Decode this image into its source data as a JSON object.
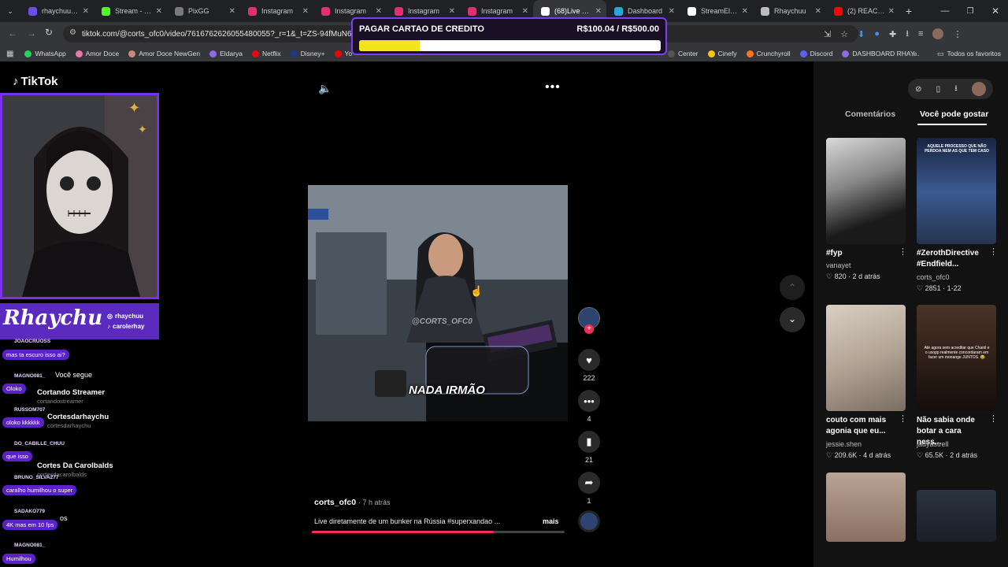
{
  "browser": {
    "tabs": [
      {
        "title": "rhaychuu - T",
        "color": "#6b4ee6"
      },
      {
        "title": "Stream - Kic",
        "color": "#53fc18"
      },
      {
        "title": "PixGG",
        "color": "#7a7a7a"
      },
      {
        "title": "Instagram",
        "color": "#e1306c"
      },
      {
        "title": "Instagram",
        "color": "#e1306c"
      },
      {
        "title": "Instagram",
        "color": "#e1306c"
      },
      {
        "title": "Instagram",
        "color": "#e1306c"
      },
      {
        "title": "(68)Live dire",
        "color": "#ffffff"
      },
      {
        "title": "Dashboard",
        "color": "#2aa7d8"
      },
      {
        "title": "StreamElem",
        "color": "#ffffff"
      },
      {
        "title": "Rhaychuu",
        "color": "#bbbbbb"
      },
      {
        "title": "(2) REACT X",
        "color": "#ff0000"
      }
    ],
    "url": "tiktok.com/@corts_ofc0/video/7616762626055480055?_r=1&_t=ZS-94fMuN6lqPl",
    "bookmarks": [
      {
        "label": "WhatsApp",
        "color": "#25d366"
      },
      {
        "label": "Amor Doce",
        "color": "#e67aa6"
      },
      {
        "label": "Amor Doce NewGen",
        "color": "#c98a7a"
      },
      {
        "label": "Eldarya",
        "color": "#8a6be0"
      },
      {
        "label": "Netflix",
        "color": "#e50914"
      },
      {
        "label": "Disney+",
        "color": "#1d3a8a"
      },
      {
        "label": "Yo",
        "color": "#ff0000"
      }
    ],
    "bookmarks_right": [
      {
        "label": "Center",
        "color": "#555555"
      },
      {
        "label": "Cinefy",
        "color": "#f2c811"
      },
      {
        "label": "Crunchyroll",
        "color": "#f47521"
      },
      {
        "label": "Discord",
        "color": "#5865f2"
      },
      {
        "label": "DASHBOARD RHAY...",
        "color": "#8a6be0"
      }
    ],
    "bookmarks_folder": "Todos os favoritos"
  },
  "goal": {
    "title": "PAGAR CARTAO DE CREDITO",
    "value": "R$100.04 / R$500.00",
    "progress": 0.2
  },
  "tiktok": {
    "logo": "TikTok",
    "video": {
      "caption_overlay": "NADA IRMÃO",
      "watermark": "@CORTS_OFC0",
      "author": "corts_ofc0",
      "time": "· 7 h atrás",
      "description": "Live diretamente de um bunker na Rússia #superxandao ...",
      "more": "mais",
      "likes": "222",
      "comments": "4",
      "saves": "21",
      "shares": "1"
    },
    "sidebar": [
      {
        "name": "Cortando Streamer",
        "handle": "cortandostreamer"
      },
      {
        "name": "Cortesdarhaychu",
        "handle": "cortesdarhaychu"
      },
      {
        "name": "Cortes Da Carolbalds",
        "handle": "cortesdacarolbalds"
      }
    ],
    "sidebar_misc": [
      "Você segue",
      "os"
    ],
    "right_tabs": {
      "comments": "Comentários",
      "like": "Você pode gostar"
    },
    "recommendations": [
      {
        "title": "#fyp",
        "user": "vanayet",
        "stats": "♡ 820 · 2 d atrás"
      },
      {
        "title": "#ZerothDirective #Endfield...",
        "user": "corts_ofc0",
        "stats": "♡ 2851 · 1-22"
      },
      {
        "title": "couto com mais agonia que eu...",
        "user": "jessie.shen",
        "stats": "♡ 209.6K · 4 d atrás"
      },
      {
        "title": "Não sabia onde botar a cara ness...",
        "user": "jadyastrell",
        "stats": "♡ 65.5K · 2 d atrás"
      }
    ],
    "thumb_texts": [
      "AQUELE PROCESSO QUE NÃO PERDOA NEM AS QUE TEM CASO",
      "Até agora sem acreditar que Chanil e o usopp realmente concordaram em fazer um monange JUNTOS. 😂"
    ]
  },
  "stream_overlay": {
    "brand": "Rhaychu",
    "socials": [
      "rhaychuu",
      "carolerhay"
    ],
    "chat": [
      {
        "user": "JOAOCRUOSS",
        "msg": "mas ta escuro isso ai?"
      },
      {
        "user": "MAGNO081_",
        "msg": "Oloko"
      },
      {
        "user": "RUSSOM707",
        "msg": "oloko kkkkkk"
      },
      {
        "user": "DO_CABILLE_CHUU",
        "msg": "que isso"
      },
      {
        "user": "BRUNO_SILVA277",
        "msg": "caralho humilhou o super"
      },
      {
        "user": "SADAKO779",
        "msg": "4K mas em 10 fps"
      },
      {
        "user": "MAGNO081_",
        "msg": "Humilhou"
      }
    ]
  }
}
